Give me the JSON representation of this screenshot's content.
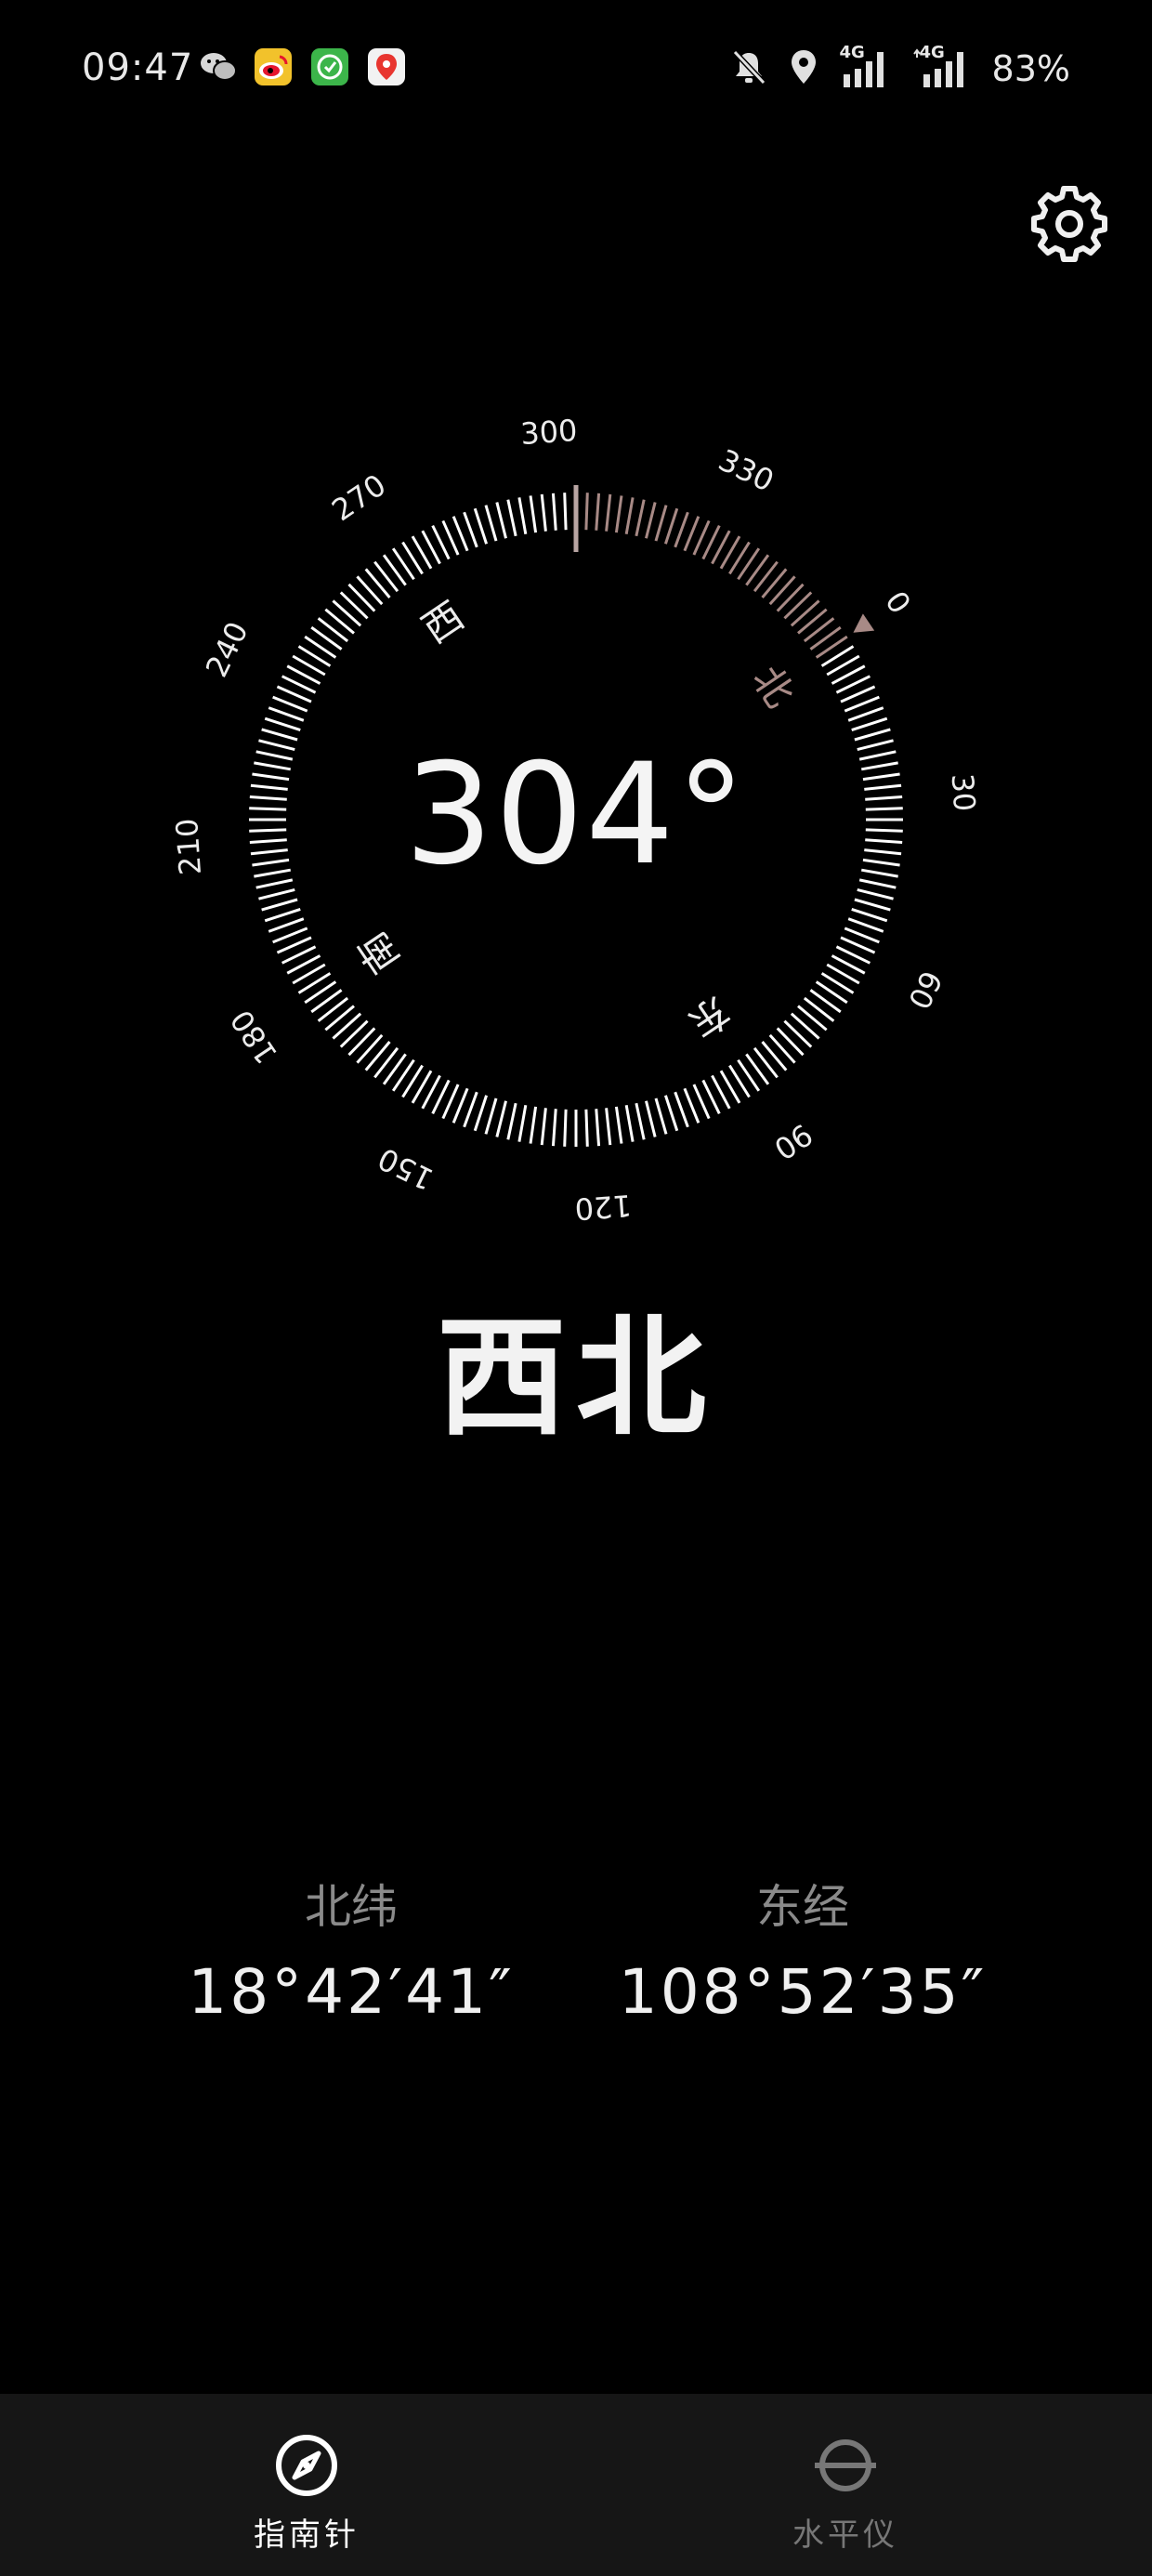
{
  "status_bar": {
    "time": "09:47",
    "notification_icons": [
      "wechat-icon",
      "weibo-icon",
      "green-app-icon",
      "map-pin-app-icon"
    ],
    "indicators": [
      "mute-icon",
      "location-icon",
      "signal-4g-icon",
      "signal-4g-icon"
    ],
    "network_label_1": "4G",
    "network_label_2": "4G",
    "battery": "83%"
  },
  "settings": {
    "icon": "gear-icon"
  },
  "compass": {
    "heading_value": 304,
    "heading_text": "304°",
    "direction_name": "西北",
    "degree_labels": [
      "0",
      "30",
      "60",
      "90",
      "120",
      "150",
      "180",
      "210",
      "240",
      "270",
      "300",
      "330"
    ],
    "cardinal_labels": {
      "north": "北",
      "east": "东",
      "south": "南",
      "west": "西"
    },
    "colors": {
      "ticks": "#ffffff",
      "north_segment": "#a88a86",
      "north_marker": "#a88a86",
      "heading_marker": "#b8a5a3"
    }
  },
  "coordinates": {
    "latitude_label": "北纬",
    "latitude_value": "18°42′41″",
    "longitude_label": "东经",
    "longitude_value": "108°52′35″"
  },
  "bottom_nav": {
    "tabs": [
      {
        "label": "指南针",
        "icon": "compass-icon",
        "active": true
      },
      {
        "label": "水平仪",
        "icon": "level-icon",
        "active": false
      }
    ],
    "active_color": "#ffffff",
    "inactive_color": "#777777"
  }
}
